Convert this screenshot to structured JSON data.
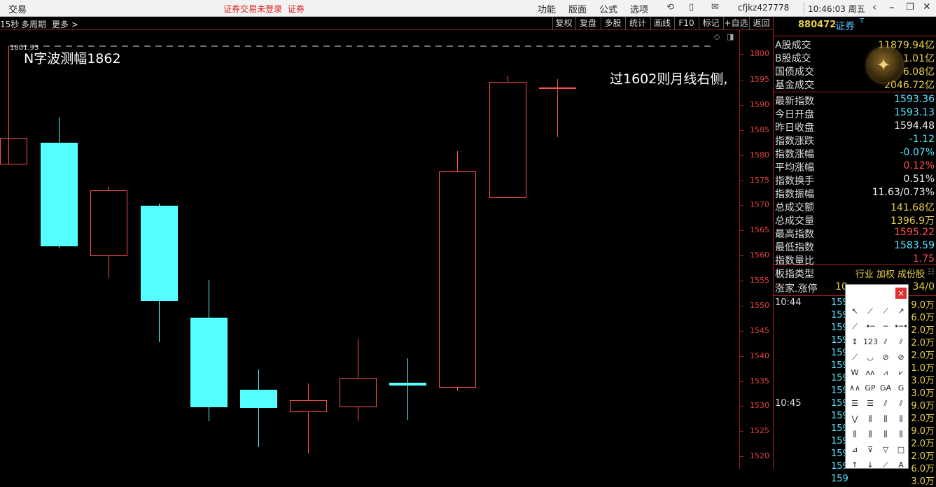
{
  "topbar": {
    "trade": "交易",
    "login_warning": "证券交易未登录",
    "securities": "证券",
    "menu": [
      "功能",
      "版面",
      "公式",
      "选项"
    ],
    "username": "cfjkz427778",
    "clock": "10:46:03 周五"
  },
  "subbar": {
    "period": "15秒",
    "multi_period": "多周期",
    "more": "更多 >",
    "buttons": [
      "复权",
      "复盘",
      "多股",
      "统计",
      "画线",
      "F10",
      "+自选",
      "返回"
    ]
  },
  "chart": {
    "annotation_left": "N字波测幅1862",
    "annotation_right": "过1602则月线右侧,",
    "corner_label": "1801.93",
    "y_labels": [
      "1800",
      "1595",
      "1590",
      "1585",
      "1580",
      "1575",
      "1570",
      "1565",
      "1560",
      "1555",
      "1550",
      "1545",
      "1540",
      "1535",
      "1530",
      "1525",
      "1520"
    ],
    "colors": {
      "up": "#ff5050",
      "down": "#55ffff",
      "axis": "#a02020"
    }
  },
  "panel": {
    "code": "880472",
    "name": "证券",
    "superscript": "T",
    "turnover": [
      {
        "k": "A股成交",
        "v": "11879.94亿"
      },
      {
        "k": "B股成交",
        "v": "1.01亿"
      },
      {
        "k": "国债成交",
        "v": "6.08亿"
      },
      {
        "k": "基金成交",
        "v": "2046.72亿"
      }
    ],
    "stats": [
      {
        "k": "最新指数",
        "v": "1593.36",
        "c": "cyan"
      },
      {
        "k": "今日开盘",
        "v": "1593.13",
        "c": "cyan"
      },
      {
        "k": "昨日收盘",
        "v": "1594.48",
        "c": "white"
      },
      {
        "k": "指数涨跌",
        "v": "-1.12",
        "c": "cyan"
      },
      {
        "k": "指数涨幅",
        "v": "-0.07%",
        "c": "cyan"
      },
      {
        "k": "平均涨幅",
        "v": "0.12%",
        "c": "red"
      },
      {
        "k": "指数换手",
        "v": "0.51%",
        "c": "white"
      },
      {
        "k": "指数振幅",
        "v": "11.63/0.73%",
        "c": "white"
      },
      {
        "k": "总成交额",
        "v": "141.68亿",
        "c": "yellow"
      },
      {
        "k": "总成交量",
        "v": "1396.9万",
        "c": "yellow"
      },
      {
        "k": "最高指数",
        "v": "1595.22",
        "c": "red"
      },
      {
        "k": "最低指数",
        "v": "1583.59",
        "c": "cyan"
      },
      {
        "k": "指数量比",
        "v": "1.75",
        "c": "red"
      }
    ],
    "board_type": "板指类型",
    "board_options": "行业 加权 成份股",
    "advancers": "涨家.涨停",
    "advancers_val": "34/0",
    "advancers_prefix": "10",
    "ticks": [
      {
        "t": "10:44",
        "p": "159",
        "v": "9.0万"
      },
      {
        "t": "",
        "p": "159",
        "v": "6.0万"
      },
      {
        "t": "",
        "p": "159",
        "v": "2.0万"
      },
      {
        "t": "",
        "p": "159",
        "v": "2.0万"
      },
      {
        "t": "",
        "p": "159",
        "v": "2.0万"
      },
      {
        "t": "",
        "p": "159",
        "v": "1.0万"
      },
      {
        "t": "",
        "p": "159",
        "v": "3.0万"
      },
      {
        "t": "",
        "p": "159",
        "v": "3.0万"
      },
      {
        "t": "10:45",
        "p": "159",
        "v": "9.0万"
      },
      {
        "t": "",
        "p": "159",
        "v": "2.0万"
      },
      {
        "t": "",
        "p": "159",
        "v": "9.0万"
      },
      {
        "t": "",
        "p": "159",
        "v": "2.0万"
      },
      {
        "t": "",
        "p": "159",
        "v": "2.0万"
      },
      {
        "t": "",
        "p": "159",
        "v": "6.0万"
      },
      {
        "t": "",
        "p": "159",
        "v": "3.0万"
      }
    ]
  },
  "toolbox": {
    "close": "×"
  }
}
